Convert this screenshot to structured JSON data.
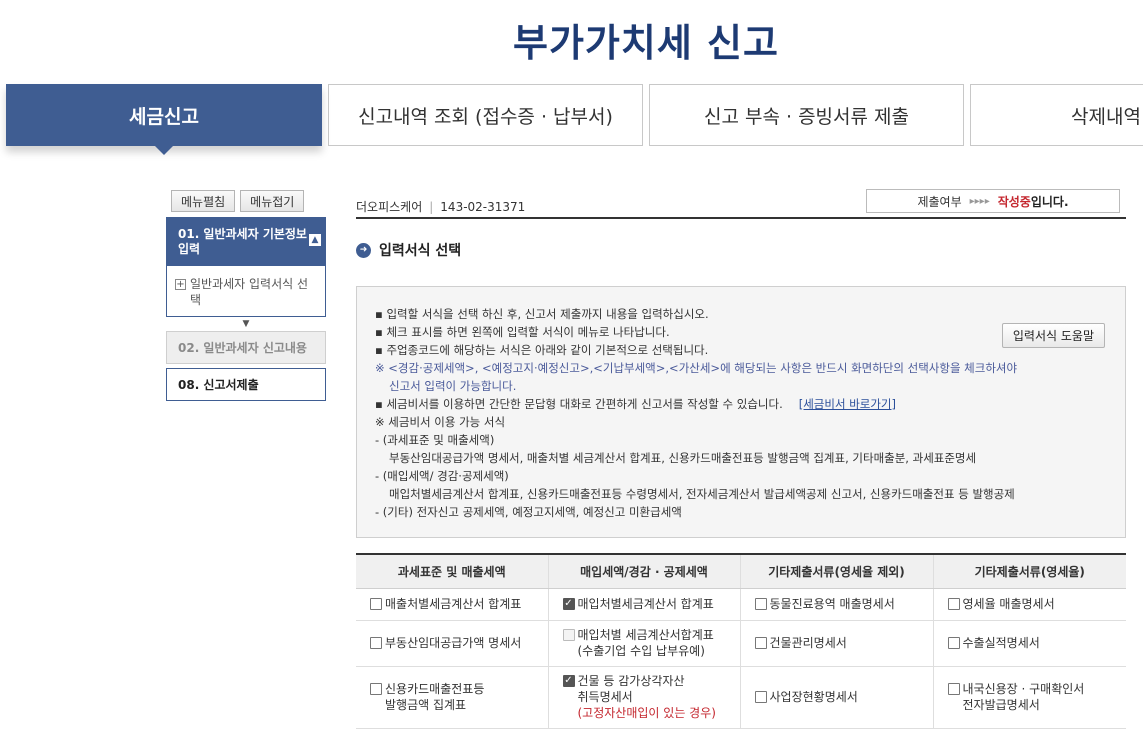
{
  "page_title": "부가가치세 신고",
  "tabs": [
    {
      "label": "세금신고",
      "active": true
    },
    {
      "label": "신고내역 조회 (접수증 · 납부서)",
      "active": false
    },
    {
      "label": "신고 부속 · 증빙서류 제출",
      "active": false
    },
    {
      "label": "삭제내역",
      "active": false
    }
  ],
  "sidebar": {
    "expand_label": "메뉴펼침",
    "collapse_label": "메뉴접기",
    "group": {
      "title": "01. 일반과세자 기본정보 입력",
      "sub_item": "일반과세자 입력서식 선택"
    },
    "items": [
      {
        "label": "02. 일반과세자 신고내용",
        "state": "disabled"
      },
      {
        "label": "08. 신고서제출",
        "state": "normal"
      }
    ]
  },
  "header": {
    "company_name": "더오피스케어",
    "business_no": "143-02-31371",
    "status_label": "제출여부",
    "status_arrows": "▸▸▸▸",
    "status_value": "작성중",
    "status_suffix": "입니다."
  },
  "section_title": "입력서식 선택",
  "info": {
    "help_button": "입력서식 도움말",
    "link_text": "[세금비서 바로가기]",
    "lines": [
      {
        "text": "▪ 입력할 서식을 선택 하신 후, 신고서 제출까지 내용을 입력하십시오.",
        "style": "normal"
      },
      {
        "text": "▪ 체크 표시를 하면 왼쪽에 입력할 서식이 메뉴로 나타납니다.",
        "style": "normal"
      },
      {
        "text": "▪ 주업종코드에 해당하는 서식은 아래와 같이 기본적으로 선택됩니다.",
        "style": "normal"
      },
      {
        "text": "※ <경감·공제세액>, <예정고지·예정신고>,<기납부세액>,<가산세>에 해당되는 사항은 반드시  화면하단의 선택사항을 체크하셔야",
        "style": "blue"
      },
      {
        "text": "신고서 입력이 가능합니다.",
        "style": "blue-indent"
      },
      {
        "text": "▪ 세금비서를 이용하면 간단한 문답형 대화로 간편하게 신고서를 작성할 수 있습니다.",
        "style": "link"
      },
      {
        "text": "※ 세금비서 이용 가능 서식",
        "style": "normal"
      },
      {
        "text": "- (과세표준 및 매출세액)",
        "style": "normal"
      },
      {
        "text": "부동산임대공급가액 명세서, 매출처별 세금계산서 합계표, 신용카드매출전표등 발행금액 집계표, 기타매출분, 과세표준명세",
        "style": "indent"
      },
      {
        "text": "- (매입세액/ 경감·공제세액)",
        "style": "normal"
      },
      {
        "text": "매입처별세금계산서 합계표, 신용카드매출전표등 수령명세서, 전자세금계산서 발급세액공제 신고서, 신용카드매출전표 등 발행공제",
        "style": "indent"
      },
      {
        "text": "- (기타) 전자신고 공제세액, 예정고지세액, 예정신고 미환급세액",
        "style": "normal"
      }
    ]
  },
  "table": {
    "headers": [
      "과세표준 및 매출세액",
      "매입세액/경감 · 공제세액",
      "기타제출서류(영세율 제외)",
      "기타제출서류(영세율)"
    ],
    "rows": [
      [
        {
          "lines": [
            "매출처별세금계산서 합계표"
          ],
          "state": "unchecked"
        },
        {
          "lines": [
            "매입처별세금계산서 합계표"
          ],
          "state": "checked"
        },
        {
          "lines": [
            "동물진료용역 매출명세서"
          ],
          "state": "unchecked"
        },
        {
          "lines": [
            "영세율 매출명세서"
          ],
          "state": "unchecked"
        }
      ],
      [
        {
          "lines": [
            "부동산임대공급가액 명세서"
          ],
          "state": "unchecked"
        },
        {
          "lines": [
            "매입처별 세금계산서합계표",
            "(수출기업 수입 납부유예)"
          ],
          "state": "disabled"
        },
        {
          "lines": [
            "건물관리명세서"
          ],
          "state": "unchecked"
        },
        {
          "lines": [
            "수출실적명세서"
          ],
          "state": "unchecked"
        }
      ],
      [
        {
          "lines": [
            "신용카드매출전표등",
            "발행금액 집계표"
          ],
          "state": "unchecked"
        },
        {
          "lines": [
            "건물 등 감가상각자산",
            "취득명세서",
            "(고정자산매입이 있는 경우)"
          ],
          "state": "checked",
          "red_last": true
        },
        {
          "lines": [
            "사업장현황명세서"
          ],
          "state": "unchecked"
        },
        {
          "lines": [
            "내국신용장 · 구매확인서",
            "전자발급명세서"
          ],
          "state": "unchecked"
        }
      ]
    ]
  }
}
